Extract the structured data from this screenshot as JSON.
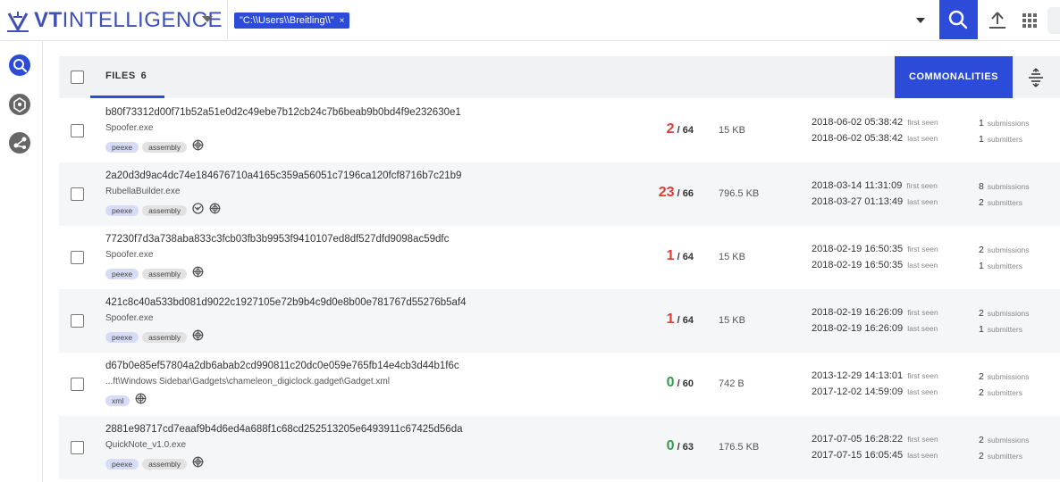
{
  "brand": {
    "bold": "VT",
    "light": "INTELLIGENCE"
  },
  "search": {
    "chip_text": "\"C:\\\\Users\\\\Breitling\\\\\"",
    "chip_close": "×"
  },
  "files_tab": {
    "label": "FILES",
    "count": "6"
  },
  "commonalities_label": "COMMONALITIES",
  "labels": {
    "first_seen": "first seen",
    "last_seen": "last seen",
    "submissions": "submissions",
    "submitters": "submitters"
  },
  "colors": {
    "accent": "#2c4bd8",
    "positive": "#e53935",
    "clean": "#2e9e4c"
  },
  "rows": [
    {
      "hash": "b80f73312d00f71b52a51e0d2c49ebe7b12cb24c7b6beab9b0bd4f9e232630e1",
      "name": "Spoofer.exe",
      "tags": [
        "peexe",
        "assembly"
      ],
      "extra_icons": [
        "target-icon"
      ],
      "positives": "2",
      "total": "/ 64",
      "status": "red",
      "size": "15 KB",
      "first_seen": "2018-06-02 05:38:42",
      "last_seen": "2018-06-02 05:38:42",
      "submissions": "1",
      "submitters": "1"
    },
    {
      "hash": "2a20d3d9ac4dc74e184676710a4165c359a56051c7196ca120fcf8716b7c21b9",
      "name": "RubellaBuilder.exe",
      "tags": [
        "peexe",
        "assembly"
      ],
      "extra_icons": [
        "network-icon",
        "target-icon"
      ],
      "positives": "23",
      "total": "/ 66",
      "status": "red",
      "size": "796.5 KB",
      "first_seen": "2018-03-14 11:31:09",
      "last_seen": "2018-03-27 01:13:49",
      "submissions": "8",
      "submitters": "2"
    },
    {
      "hash": "77230f7d3a738aba833c3fcb03fb3b9953f9410107ed8df527dfd9098ac59dfc",
      "name": "Spoofer.exe",
      "tags": [
        "peexe",
        "assembly"
      ],
      "extra_icons": [
        "target-icon"
      ],
      "positives": "1",
      "total": "/ 64",
      "status": "red",
      "size": "15 KB",
      "first_seen": "2018-02-19 16:50:35",
      "last_seen": "2018-02-19 16:50:35",
      "submissions": "2",
      "submitters": "1"
    },
    {
      "hash": "421c8c40a533bd081d9022c1927105e72b9b4c9d0e8b00e781767d55276b5af4",
      "name": "Spoofer.exe",
      "tags": [
        "peexe",
        "assembly"
      ],
      "extra_icons": [
        "target-icon"
      ],
      "positives": "1",
      "total": "/ 64",
      "status": "red",
      "size": "15 KB",
      "first_seen": "2018-02-19 16:26:09",
      "last_seen": "2018-02-19 16:26:09",
      "submissions": "2",
      "submitters": "1"
    },
    {
      "hash": "d67b0e85ef57804a2db6abab2cd990811c20dc0e059e765fb14e4cb3d44b1f6c",
      "name": "...ft\\Windows Sidebar\\Gadgets\\chameleon_digiclock.gadget\\Gadget.xml",
      "tags": [
        "xml"
      ],
      "extra_icons": [
        "target-icon"
      ],
      "positives": "0",
      "total": "/ 60",
      "status": "green",
      "size": "742 B",
      "first_seen": "2013-12-29 14:13:01",
      "last_seen": "2017-12-02 14:59:09",
      "submissions": "2",
      "submitters": "2"
    },
    {
      "hash": "2881e98717cd7eaaf9b4d6ed4a688f1c68cd252513205e6493911c67425d56da",
      "name": "QuickNote_v1.0.exe",
      "tags": [
        "peexe",
        "assembly"
      ],
      "extra_icons": [
        "target-icon"
      ],
      "positives": "0",
      "total": "/ 63",
      "status": "green",
      "size": "176.5 KB",
      "first_seen": "2017-07-05 16:28:22",
      "last_seen": "2017-07-15 16:05:45",
      "submissions": "2",
      "submitters": "2"
    }
  ]
}
